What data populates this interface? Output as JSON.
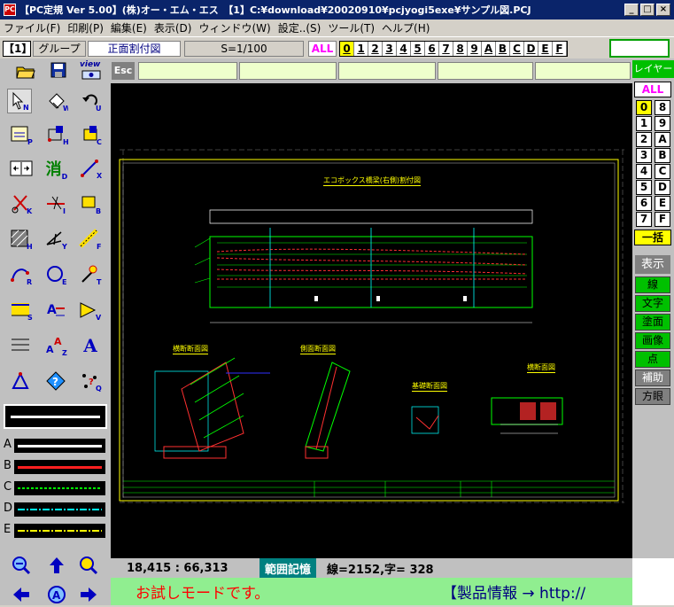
{
  "window": {
    "title": "【PC定規 Ver 5.00】(株)オー・エム・エス　【1】C:¥download¥20020910¥pcjyogi5exe¥サンプル図.PCJ",
    "icon": "PC",
    "minimize": "_",
    "maximize": "□",
    "close": "×"
  },
  "menu": [
    "ファイル(F)",
    "印刷(P)",
    "編集(E)",
    "表示(D)",
    "ウィンドウ(W)",
    "設定..(S)",
    "ツール(T)",
    "ヘルプ(H)"
  ],
  "toolbar": {
    "sheet": "【1】",
    "group_label": "グループ",
    "view_name": "正面割付図",
    "scale": "S=1/100",
    "all_label": "ALL",
    "layers": [
      "0",
      "1",
      "2",
      "3",
      "4",
      "5",
      "6",
      "7",
      "8",
      "9",
      "A",
      "B",
      "C",
      "D",
      "E",
      "F"
    ],
    "esc": "Esc",
    "view_label": "view"
  },
  "right_panel": {
    "title": "レイヤー",
    "all": "ALL",
    "layer_pairs": [
      [
        "0",
        "8"
      ],
      [
        "1",
        "9"
      ],
      [
        "2",
        "A"
      ],
      [
        "3",
        "B"
      ],
      [
        "4",
        "C"
      ],
      [
        "5",
        "D"
      ],
      [
        "6",
        "E"
      ],
      [
        "7",
        "F"
      ]
    ],
    "bulk": "一括",
    "display": "表示",
    "buttons": [
      "線",
      "文字",
      "塗面",
      "画像",
      "点",
      "補助",
      "方眼"
    ]
  },
  "left_panel": {
    "line_labels": [
      "A",
      "B",
      "C",
      "D",
      "E"
    ],
    "tool_letters": [
      "N",
      "W",
      "U",
      "P",
      "H",
      "C",
      "",
      "D",
      "X",
      "K",
      "I",
      "B",
      "H",
      "Y",
      "F",
      "R",
      "E",
      "T",
      "S",
      "V",
      "Z",
      "Q"
    ],
    "delete_glyph": "消",
    "text_glyph": "A"
  },
  "drawing": {
    "title_main": "エコボックス橋梁(右側)割付図",
    "title_s1": "横断断面図",
    "title_s2": "側面断面図",
    "title_s3": "基礎断面図",
    "title_s4": "横断面図"
  },
  "status": {
    "coords": "18,415 : 66,313",
    "range_button": "範囲記憶",
    "counts": "線=2152,字= 328"
  },
  "trial": {
    "message": "お試しモードです。",
    "link": "【製品情報 → http://"
  },
  "colors": {
    "active_layer": "#ffff00",
    "all_text": "#ff00ff",
    "green_button": "#00c000",
    "trial_bg": "#90ee90",
    "trial_text": "#ff0000"
  }
}
